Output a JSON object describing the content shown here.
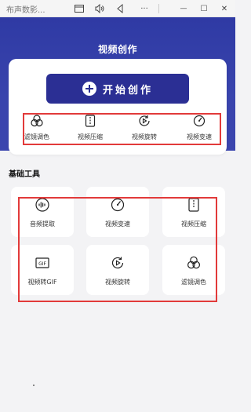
{
  "window": {
    "title": "布声数影...",
    "controls": [
      "restore-icon",
      "volume-icon",
      "back-icon",
      "more-icon",
      "minimize-icon",
      "maximize-icon",
      "close-icon"
    ],
    "more_glyph": "···",
    "minimize_glyph": "—",
    "maximize_glyph": "☐",
    "close_glyph": "✕"
  },
  "header": {
    "title": "视频创作",
    "background_color": "#3540a8"
  },
  "start_button": {
    "label": "开始创作",
    "color": "#2b2f94"
  },
  "quick_actions": [
    {
      "label": "滤镜调色",
      "icon": "filter-icon"
    },
    {
      "label": "视频压缩",
      "icon": "compress-icon"
    },
    {
      "label": "视频旋转",
      "icon": "rotate-icon"
    },
    {
      "label": "视频变速",
      "icon": "speed-icon"
    }
  ],
  "tools_section": {
    "title": "基础工具",
    "items": [
      {
        "label": "音频提取",
        "icon": "audio-extract-icon"
      },
      {
        "label": "视频变速",
        "icon": "speed-icon"
      },
      {
        "label": "视频压缩",
        "icon": "compress-icon"
      },
      {
        "label": "视频转GIF",
        "icon": "gif-icon"
      },
      {
        "label": "视频旋转",
        "icon": "rotate-icon"
      },
      {
        "label": "滤镜调色",
        "icon": "filter-icon"
      }
    ]
  },
  "highlight_color": "#e23a3a"
}
